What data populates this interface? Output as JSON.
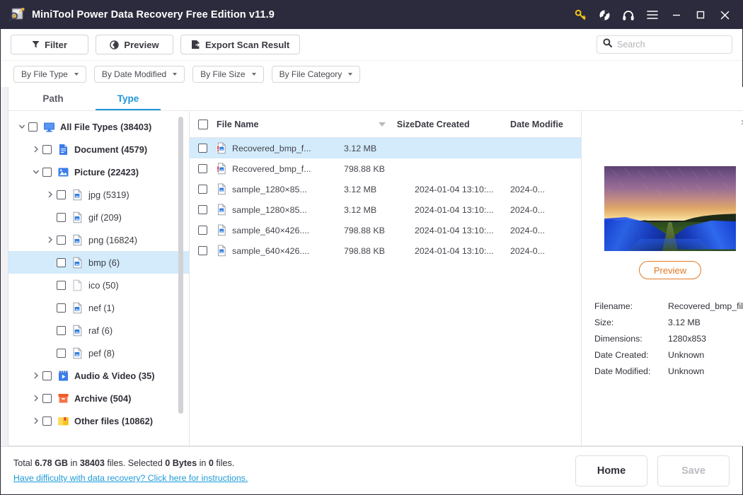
{
  "window": {
    "title": "MiniTool Power Data Recovery Free Edition v11.9",
    "logo_icon": "app-logo-icon",
    "controls": [
      {
        "name": "key-icon",
        "glyph": "key"
      },
      {
        "name": "disc-icon",
        "glyph": "disc"
      },
      {
        "name": "headphones-icon",
        "glyph": "headphones"
      },
      {
        "name": "menu-icon",
        "glyph": "menu"
      },
      {
        "name": "minimize-icon",
        "glyph": "minimize"
      },
      {
        "name": "maximize-icon",
        "glyph": "maximize"
      },
      {
        "name": "close-icon",
        "glyph": "close"
      }
    ],
    "titlebar_bg": "#2b2b3d"
  },
  "toolbar": {
    "filter_label": "Filter",
    "preview_label": "Preview",
    "export_label": "Export Scan Result",
    "search_placeholder": "Search",
    "search_value": ""
  },
  "filters": [
    {
      "label": "By File Type"
    },
    {
      "label": "By Date Modified"
    },
    {
      "label": "By File Size"
    },
    {
      "label": "By File Category"
    }
  ],
  "tabs": [
    {
      "label": "Path",
      "active": false
    },
    {
      "label": "Type",
      "active": true
    }
  ],
  "tree": [
    {
      "label": "All File Types (38403)",
      "depth": 0,
      "arrow": "down",
      "icon": "monitor",
      "bold": true,
      "selected": false
    },
    {
      "label": "Document (4579)",
      "depth": 1,
      "arrow": "right",
      "icon": "doc",
      "bold": true,
      "selected": false
    },
    {
      "label": "Picture (22423)",
      "depth": 1,
      "arrow": "down",
      "icon": "picture",
      "bold": true,
      "selected": false
    },
    {
      "label": "jpg (5319)",
      "depth": 2,
      "arrow": "right",
      "icon": "filepic",
      "bold": false,
      "selected": false
    },
    {
      "label": "gif (209)",
      "depth": 2,
      "arrow": "none",
      "icon": "filepic",
      "bold": false,
      "selected": false
    },
    {
      "label": "png (16824)",
      "depth": 2,
      "arrow": "right",
      "icon": "filepic",
      "bold": false,
      "selected": false
    },
    {
      "label": "bmp (6)",
      "depth": 2,
      "arrow": "none",
      "icon": "filepic",
      "bold": false,
      "selected": true
    },
    {
      "label": "ico (50)",
      "depth": 2,
      "arrow": "none",
      "icon": "fileblank",
      "bold": false,
      "selected": false
    },
    {
      "label": "nef (1)",
      "depth": 2,
      "arrow": "none",
      "icon": "filepic",
      "bold": false,
      "selected": false
    },
    {
      "label": "raf (6)",
      "depth": 2,
      "arrow": "none",
      "icon": "filepic",
      "bold": false,
      "selected": false
    },
    {
      "label": "pef (8)",
      "depth": 2,
      "arrow": "none",
      "icon": "filepic",
      "bold": false,
      "selected": false
    },
    {
      "label": "Audio & Video (35)",
      "depth": 1,
      "arrow": "right",
      "icon": "video",
      "bold": true,
      "selected": false
    },
    {
      "label": "Archive (504)",
      "depth": 1,
      "arrow": "right",
      "icon": "archive",
      "bold": true,
      "selected": false
    },
    {
      "label": "Other files (10862)",
      "depth": 1,
      "arrow": "right",
      "icon": "other",
      "bold": true,
      "selected": false
    }
  ],
  "filelist": {
    "columns": [
      "File Name",
      "Size",
      "Date Created",
      "Date Modifie"
    ],
    "sort_column": "File Name",
    "rows": [
      {
        "name": "Recovered_bmp_f...",
        "size": "3.12 MB",
        "created": "",
        "modified": "",
        "icon": "file-warning",
        "selected": true
      },
      {
        "name": "Recovered_bmp_f...",
        "size": "798.88 KB",
        "created": "",
        "modified": "",
        "icon": "file-warning",
        "selected": false
      },
      {
        "name": "sample_1280×85...",
        "size": "3.12 MB",
        "created": "2024-01-04 13:10:...",
        "modified": "2024-0...",
        "icon": "file-image",
        "selected": false
      },
      {
        "name": "sample_1280×85...",
        "size": "3.12 MB",
        "created": "2024-01-04 13:10:...",
        "modified": "2024-0...",
        "icon": "file-image",
        "selected": false
      },
      {
        "name": "sample_640×426....",
        "size": "798.88 KB",
        "created": "2024-01-04 13:10:...",
        "modified": "2024-0...",
        "icon": "file-image",
        "selected": false
      },
      {
        "name": "sample_640×426....",
        "size": "798.88 KB",
        "created": "2024-01-04 13:10:...",
        "modified": "2024-0...",
        "icon": "file-image",
        "selected": false
      }
    ]
  },
  "preview": {
    "close_glyph": "×",
    "button_label": "Preview",
    "button_color": "#e07a24",
    "details": [
      {
        "key": "Filename:",
        "value": "Recovered_bmp_file"
      },
      {
        "key": "Size:",
        "value": "3.12 MB"
      },
      {
        "key": "Dimensions:",
        "value": "1280x853"
      },
      {
        "key": "Date Created:",
        "value": "Unknown"
      },
      {
        "key": "Date Modified:",
        "value": "Unknown"
      }
    ]
  },
  "footer": {
    "total_prefix": "Total ",
    "total_size": "6.78 GB",
    "total_mid": " in ",
    "total_count": "38403",
    "total_suffix": " files.  Selected ",
    "selected_size": "0 Bytes",
    "selected_mid": " in ",
    "selected_count": "0",
    "selected_suffix": " files.",
    "help_link": "Have difficulty with data recovery? Click here for instructions.",
    "home_label": "Home",
    "save_label": "Save"
  }
}
